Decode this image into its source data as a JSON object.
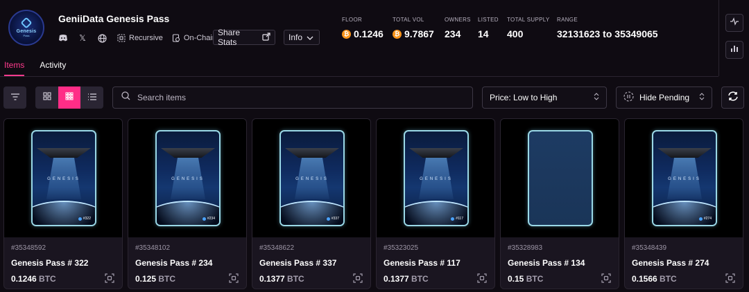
{
  "collection": {
    "title": "GeniiData Genesis Pass",
    "avatar": {
      "text": "Genesis",
      "sub": "Pass"
    },
    "tags": [
      "Recursive",
      "On-Chain"
    ],
    "share_label": "Share Stats",
    "info_label": "Info"
  },
  "stats": {
    "floor": {
      "label": "FLOOR",
      "value": "0.1246"
    },
    "total_vol": {
      "label": "TOTAL VOL",
      "value": "9.7867"
    },
    "owners": {
      "label": "OWNERS",
      "value": "234"
    },
    "listed": {
      "label": "LISTED",
      "value": "14"
    },
    "total_supply": {
      "label": "TOTAL SUPPLY",
      "value": "400"
    },
    "range": {
      "label": "RANGE",
      "value": "32131623 to 35349065"
    }
  },
  "tabs": [
    {
      "label": "Items",
      "active": true
    },
    {
      "label": "Activity",
      "active": false
    }
  ],
  "toolbar": {
    "search_placeholder": "Search items",
    "sort_value": "Price: Low to High",
    "pending_value": "Hide Pending"
  },
  "pass_word": "GENESIS",
  "items": [
    {
      "inscription": "#35348592",
      "name": "Genesis Pass # 322",
      "price": "0.1246",
      "unit": "BTC",
      "badge": "#322",
      "blank": false
    },
    {
      "inscription": "#35348102",
      "name": "Genesis Pass # 234",
      "price": "0.125",
      "unit": "BTC",
      "badge": "#234",
      "blank": false
    },
    {
      "inscription": "#35348622",
      "name": "Genesis Pass # 337",
      "price": "0.1377",
      "unit": "BTC",
      "badge": "#337",
      "blank": false
    },
    {
      "inscription": "#35323025",
      "name": "Genesis Pass # 117",
      "price": "0.1377",
      "unit": "BTC",
      "badge": "#117",
      "blank": false
    },
    {
      "inscription": "#35328983",
      "name": "Genesis Pass # 134",
      "price": "0.15",
      "unit": "BTC",
      "badge": "",
      "blank": true
    },
    {
      "inscription": "#35348439",
      "name": "Genesis Pass # 274",
      "price": "0.1566",
      "unit": "BTC",
      "badge": "#274",
      "blank": false
    }
  ],
  "colors": {
    "accent": "#ff2d87",
    "btc": "#f7931a",
    "background": "#0f0b12"
  }
}
